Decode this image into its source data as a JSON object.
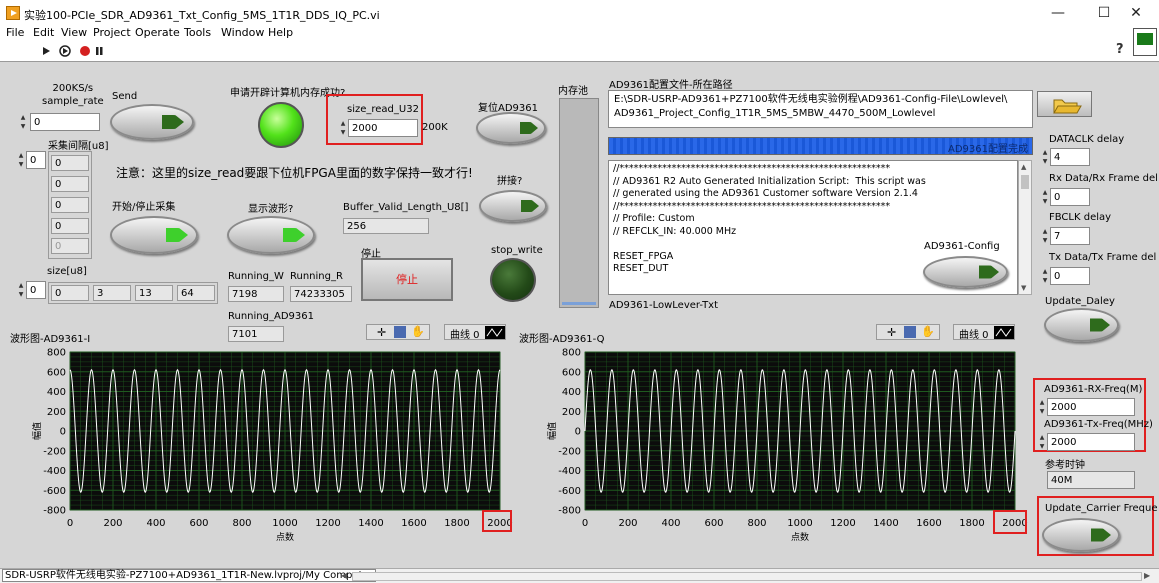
{
  "window": {
    "title": "实验100-PCIe_SDR_AD9361_Txt_Config_5MS_1T1R_DDS_IQ_PC.vi",
    "minimize": "—",
    "maximize": "☐",
    "close": "✕"
  },
  "menu": [
    "File",
    "Edit",
    "View",
    "Project",
    "Operate",
    "Tools",
    "Window",
    "Help"
  ],
  "toolbar": {
    "help_icon": "?"
  },
  "controls": {
    "sample_rate_label": "200KS/s\nsample_rate",
    "sample_rate_value": "0",
    "send_label": "Send",
    "sample_interval_label": "采集间隔[u8]",
    "sample_interval_index": "0",
    "sample_interval_values": [
      "0",
      "0",
      "0",
      "0",
      "0",
      "0"
    ],
    "size_label": "size[u8]",
    "size_index": "0",
    "size_values": [
      "0",
      "3",
      "13",
      "64"
    ],
    "memory_request_label": "申请开辟计算机内存成功?",
    "size_read_label": "size_read_U32",
    "size_read_value": "2000",
    "size_read_unit": "200K",
    "reset_label": "复位AD9361",
    "splice_label": "拼接?",
    "note": "注意：这里的size_read要跟下位机FPGA里面的数字保持一致才行!",
    "start_stop_label": "开始/停止采集",
    "show_wave_label": "显示波形?",
    "buffer_valid_label": "Buffer_Valid_Length_U8[]",
    "buffer_valid_value": "256",
    "stop_label": "停止",
    "stop_button": "停止",
    "stop_write_label": "stop_write",
    "running_w_label": "Running_W",
    "running_w_value": "7198",
    "running_r_label": "Running_R",
    "running_r_value": "74233305",
    "running_ad_label": "Running_AD9361",
    "running_ad_value": "7101",
    "mem_pool_label": "内存池",
    "config_path_label": "AD9361配置文件-所在路径",
    "config_path_value": "E:\\SDR-USRP-AD9361+PZ7100软件无线电实验例程\\AD9361-Config-File\\Lowlevel\\\nAD9361_Project_Config_1T1R_5MS_5MBW_4470_500M_Lowlevel",
    "config_done_label": "AD9361配置完成",
    "config_script": "//*********************************************************\n// AD9361 R2 Auto Generated Initialization Script:  This script was\n// generated using the AD9361 Customer software Version 2.1.4\n//*********************************************************\n// Profile: Custom\n// REFCLK_IN: 40.000 MHz\n\nRESET_FPGA\nRESET_DUT",
    "ad_config_button_label": "AD9361-Config",
    "lowlever_txt_label": "AD9361-LowLever-Txt",
    "dataclk_label": "DATACLK delay",
    "dataclk_value": "4",
    "rx_frame_label": "Rx Data/Rx Frame del",
    "rx_frame_value": "0",
    "fbclk_label": "FBCLK delay",
    "fbclk_value": "7",
    "tx_frame_label": "Tx Data/Tx Frame del",
    "tx_frame_value": "0",
    "update_delay_label": "Update_Daley",
    "rx_freq_label": "AD9361-RX-Freq(M)",
    "rx_freq_value": "2000",
    "tx_freq_label": "AD9361-Tx-Freq(MHz)",
    "tx_freq_value": "2000",
    "ref_clock_label": "参考时钟",
    "ref_clock_value": "40M",
    "update_carrier_label": "Update_Carrier Freque"
  },
  "graph_i": {
    "title": "波形图-AD9361-I",
    "legend": "曲线 0",
    "ylabel": "幅值",
    "xlabel": "点数"
  },
  "graph_q": {
    "title": "波形图-AD9361-Q",
    "legend": "曲线 0",
    "ylabel": "幅值",
    "xlabel": "点数"
  },
  "chart_data": [
    {
      "type": "line",
      "title": "波形图-AD9361-I",
      "xlabel": "点数",
      "ylabel": "幅值",
      "xlim": [
        0,
        2000
      ],
      "ylim": [
        -800,
        800
      ],
      "xticks": [
        "0",
        "200",
        "400",
        "600",
        "800",
        "1000",
        "1200",
        "1400",
        "1600",
        "1800",
        "2000"
      ],
      "yticks": [
        "800",
        "600",
        "400",
        "200",
        "0",
        "-200",
        "-400",
        "-600",
        "-800"
      ],
      "series": [
        {
          "waveform": "sine",
          "amplitude": 620,
          "cycles": 20,
          "phase_deg": 90,
          "points": 2000
        }
      ],
      "grid": true,
      "colors": {
        "line": "#ffffff",
        "background": "#0c0c0c",
        "grid": "#1f5a1f"
      }
    },
    {
      "type": "line",
      "title": "波形图-AD9361-Q",
      "xlabel": "点数",
      "ylabel": "幅值",
      "xlim": [
        0,
        2000
      ],
      "ylim": [
        -800,
        800
      ],
      "xticks": [
        "0",
        "200",
        "400",
        "600",
        "800",
        "1000",
        "1200",
        "1400",
        "1600",
        "1800",
        "2000"
      ],
      "yticks": [
        "800",
        "600",
        "400",
        "200",
        "0",
        "-200",
        "-400",
        "-600",
        "-800"
      ],
      "series": [
        {
          "waveform": "sine",
          "amplitude": 620,
          "cycles": 20,
          "phase_deg": 0,
          "points": 2000
        }
      ],
      "grid": true,
      "colors": {
        "line": "#ffffff",
        "background": "#0c0c0c",
        "grid": "#1f5a1f"
      }
    }
  ],
  "status": {
    "path": "SDR-USRP软件无线电实验-PZ7100+AD9361_1T1R-New.lvproj/My Computer"
  }
}
